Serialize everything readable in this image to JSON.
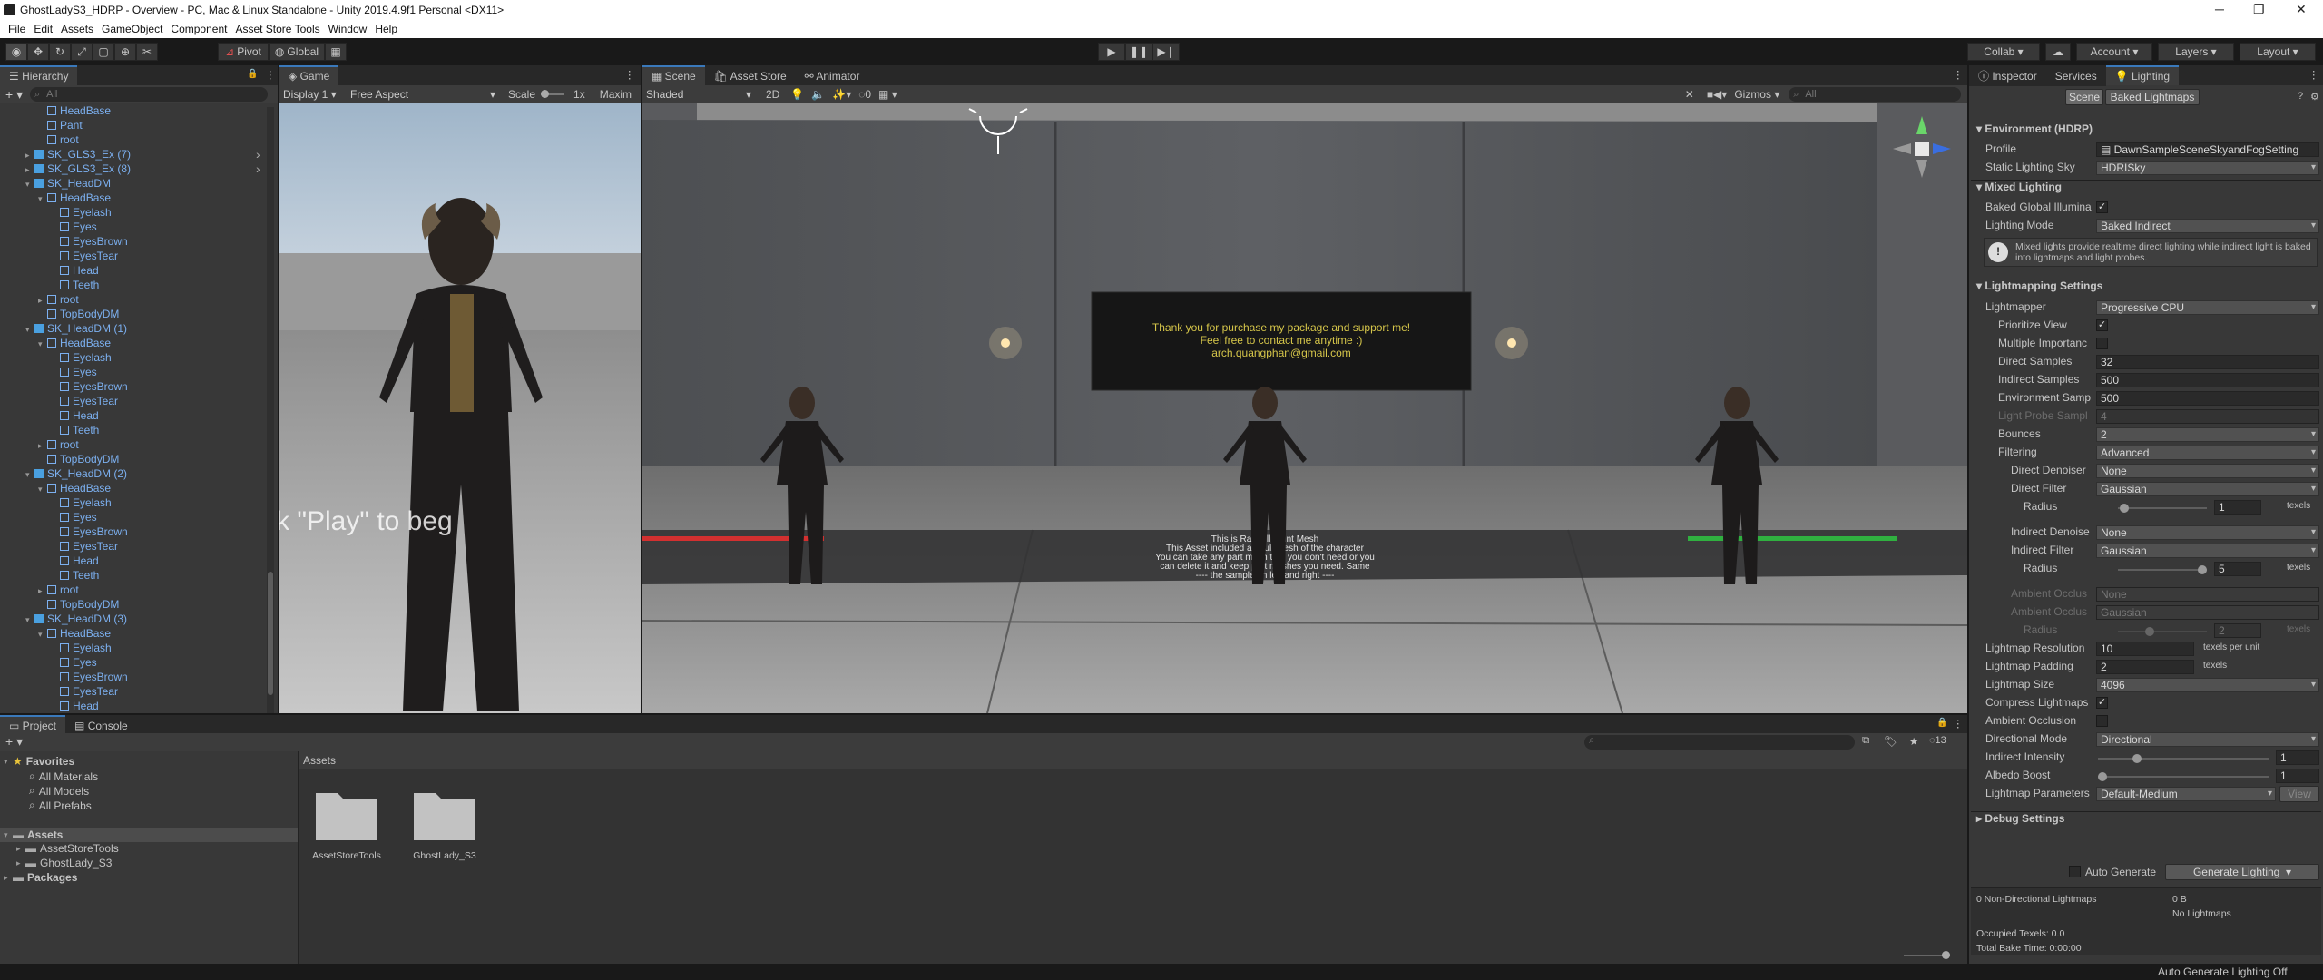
{
  "window": {
    "title": "GhostLadyS3_HDRP - Overview - PC, Mac & Linux Standalone - Unity 2019.4.9f1 Personal <DX11>",
    "min": "─",
    "max": "❐",
    "close": "✕"
  },
  "menu": [
    "File",
    "Edit",
    "Assets",
    "GameObject",
    "Component",
    "Asset Store Tools",
    "Window",
    "Help"
  ],
  "toolbar": {
    "pivot": "Pivot",
    "global": "Global",
    "collab": "Collab ▾",
    "account": "Account",
    "layers": "Layers",
    "layout": "Layout"
  },
  "hierarchy": {
    "tab": "Hierarchy",
    "search_placeholder": "All",
    "items": [
      {
        "t": "HeadBase",
        "d": 2,
        "e": 0,
        "c": 0
      },
      {
        "t": "Pant",
        "d": 2,
        "e": 0,
        "c": 0
      },
      {
        "t": "root",
        "d": 2,
        "e": 0,
        "c": 0
      },
      {
        "t": "SK_GLS3_Ex (7)",
        "d": 1,
        "e": 1,
        "c": 1,
        "arr": 1
      },
      {
        "t": "SK_GLS3_Ex (8)",
        "d": 1,
        "e": 1,
        "c": 1,
        "arr": 1
      },
      {
        "t": "SK_HeadDM",
        "d": 1,
        "e": 2,
        "c": 1
      },
      {
        "t": "HeadBase",
        "d": 2,
        "e": 2,
        "c": 0
      },
      {
        "t": "Eyelash",
        "d": 3,
        "e": 0,
        "c": 0
      },
      {
        "t": "Eyes",
        "d": 3,
        "e": 0,
        "c": 0
      },
      {
        "t": "EyesBrown",
        "d": 3,
        "e": 0,
        "c": 0
      },
      {
        "t": "EyesTear",
        "d": 3,
        "e": 0,
        "c": 0
      },
      {
        "t": "Head",
        "d": 3,
        "e": 0,
        "c": 0
      },
      {
        "t": "Teeth",
        "d": 3,
        "e": 0,
        "c": 0
      },
      {
        "t": "root",
        "d": 2,
        "e": 1,
        "c": 0
      },
      {
        "t": "TopBodyDM",
        "d": 2,
        "e": 0,
        "c": 0
      },
      {
        "t": "SK_HeadDM (1)",
        "d": 1,
        "e": 2,
        "c": 1
      },
      {
        "t": "HeadBase",
        "d": 2,
        "e": 2,
        "c": 0
      },
      {
        "t": "Eyelash",
        "d": 3,
        "e": 0,
        "c": 0
      },
      {
        "t": "Eyes",
        "d": 3,
        "e": 0,
        "c": 0
      },
      {
        "t": "EyesBrown",
        "d": 3,
        "e": 0,
        "c": 0
      },
      {
        "t": "EyesTear",
        "d": 3,
        "e": 0,
        "c": 0
      },
      {
        "t": "Head",
        "d": 3,
        "e": 0,
        "c": 0
      },
      {
        "t": "Teeth",
        "d": 3,
        "e": 0,
        "c": 0
      },
      {
        "t": "root",
        "d": 2,
        "e": 1,
        "c": 0
      },
      {
        "t": "TopBodyDM",
        "d": 2,
        "e": 0,
        "c": 0
      },
      {
        "t": "SK_HeadDM (2)",
        "d": 1,
        "e": 2,
        "c": 1
      },
      {
        "t": "HeadBase",
        "d": 2,
        "e": 2,
        "c": 0
      },
      {
        "t": "Eyelash",
        "d": 3,
        "e": 0,
        "c": 0
      },
      {
        "t": "Eyes",
        "d": 3,
        "e": 0,
        "c": 0
      },
      {
        "t": "EyesBrown",
        "d": 3,
        "e": 0,
        "c": 0
      },
      {
        "t": "EyesTear",
        "d": 3,
        "e": 0,
        "c": 0
      },
      {
        "t": "Head",
        "d": 3,
        "e": 0,
        "c": 0
      },
      {
        "t": "Teeth",
        "d": 3,
        "e": 0,
        "c": 0
      },
      {
        "t": "root",
        "d": 2,
        "e": 1,
        "c": 0
      },
      {
        "t": "TopBodyDM",
        "d": 2,
        "e": 0,
        "c": 0
      },
      {
        "t": "SK_HeadDM (3)",
        "d": 1,
        "e": 2,
        "c": 1
      },
      {
        "t": "HeadBase",
        "d": 2,
        "e": 2,
        "c": 0
      },
      {
        "t": "Eyelash",
        "d": 3,
        "e": 0,
        "c": 0
      },
      {
        "t": "Eyes",
        "d": 3,
        "e": 0,
        "c": 0
      },
      {
        "t": "EyesBrown",
        "d": 3,
        "e": 0,
        "c": 0
      },
      {
        "t": "EyesTear",
        "d": 3,
        "e": 0,
        "c": 0
      },
      {
        "t": "Head",
        "d": 3,
        "e": 0,
        "c": 0
      }
    ]
  },
  "game": {
    "tab": "Game",
    "display": "Display 1",
    "aspect": "Free Aspect",
    "scale": "Scale",
    "scale_val": "1x",
    "maxim": "Maxim",
    "overlay_text": "k \"Play\" to beg"
  },
  "scene": {
    "tabs": [
      "Scene",
      "Asset Store",
      "Animator"
    ],
    "shaded": "Shaded",
    "mode2d": "2D",
    "gizmos": "Gizmos",
    "search_placeholder": "All",
    "layer0": "0",
    "sign": [
      "Thank you for purchase my package and support me!",
      "Feel free to contact me anytime :)",
      "arch.quangphan@gmail.com"
    ],
    "floor_text": [
      "This is Ragdoll Paint Mesh",
      "This Asset included all Pull Mesh of the character",
      "You can take any part mesh that you don't need or you",
      "can delete it and keep part meshes you need. Same",
      "---- the sample on left and right ----"
    ]
  },
  "project": {
    "tabs": [
      "Project",
      "Console"
    ],
    "favorites": "Favorites",
    "fav_items": [
      "All Materials",
      "All Models",
      "All Prefabs"
    ],
    "assets": "Assets",
    "asset_items": [
      "AssetStoreTools",
      "GhostLady_S3"
    ],
    "packages": "Packages",
    "breadcrumb": "Assets",
    "folders": [
      "AssetStoreTools",
      "GhostLady_S3"
    ],
    "count": "13"
  },
  "inspector": {
    "tabs": [
      "Inspector",
      "Services",
      "Lighting"
    ],
    "sub_tabs": [
      "Scene",
      "Baked Lightmaps"
    ],
    "env": "Environment (HDRP)",
    "profile_label": "Profile",
    "profile": "DawnSampleSceneSkyandFogSetting",
    "static_sky_label": "Static Lighting Sky",
    "static_sky": "HDRISky",
    "mixed": "Mixed Lighting",
    "bgi_label": "Baked Global Illumina",
    "lmode_label": "Lighting Mode",
    "lmode": "Baked Indirect",
    "info": "Mixed lights provide realtime direct lighting while indirect light is baked into lightmaps and light probes.",
    "lms": "Lightmapping Settings",
    "lightmapper_label": "Lightmapper",
    "lightmapper": "Progressive CPU",
    "prior_label": "Prioritize View",
    "multi_label": "Multiple Importanc",
    "ds_label": "Direct Samples",
    "ds": "32",
    "is_label": "Indirect Samples",
    "is": "500",
    "es_label": "Environment Samp",
    "es": "500",
    "lp_label": "Light Probe Sampl",
    "lp": "4",
    "bounces_label": "Bounces",
    "bounces": "2",
    "filtering_label": "Filtering",
    "filtering": "Advanced",
    "dden_label": "Direct Denoiser",
    "dden": "None",
    "dfilt_label": "Direct Filter",
    "dfilt": "Gaussian",
    "radius_label": "Radius",
    "dradius": "1",
    "texels": "texels",
    "iden_label": "Indirect Denoise",
    "iden": "None",
    "ifilt_label": "Indirect Filter",
    "ifilt": "Gaussian",
    "iradius": "5",
    "aoden_label": "Ambient Occlus",
    "aoden": "None",
    "aofilt_label": "Ambient Occlus",
    "aofilt": "Gaussian",
    "aoradius": "2",
    "res_label": "Lightmap Resolution",
    "res": "10",
    "tpu": "texels per unit",
    "pad_label": "Lightmap Padding",
    "pad": "2",
    "size_label": "Lightmap Size",
    "size": "4096",
    "compress_label": "Compress Lightmaps",
    "ao_label": "Ambient Occlusion",
    "dir_label": "Directional Mode",
    "dir": "Directional",
    "ii_label": "Indirect Intensity",
    "ii": "1",
    "ab_label": "Albedo Boost",
    "ab": "1",
    "params_label": "Lightmap Parameters",
    "params": "Default-Medium",
    "view": "View",
    "debug": "Debug Settings",
    "auto_gen": "Auto Generate",
    "gen": "Generate Lighting",
    "stats": [
      "0 Non-Directional Lightmaps",
      "0 B",
      "No Lightmaps",
      "Occupied Texels: 0.0",
      "Total Bake Time: 0:00:00"
    ]
  },
  "status": "Auto Generate Lighting Off"
}
